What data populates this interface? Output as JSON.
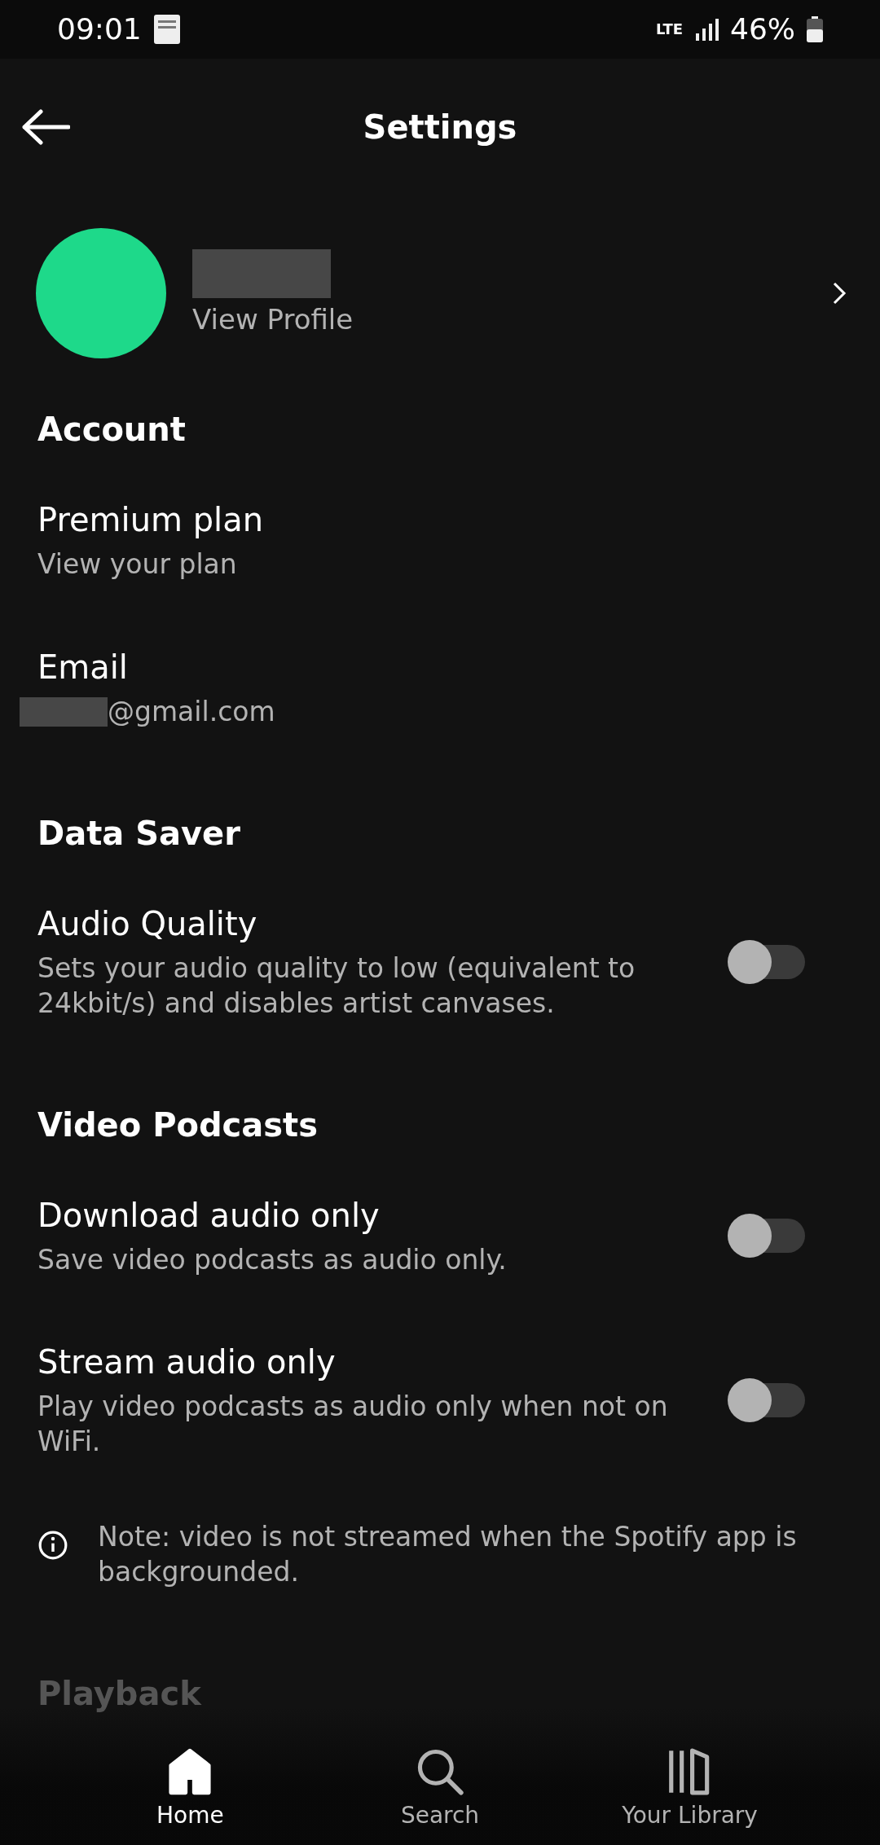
{
  "status_bar": {
    "time": "09:01",
    "network": "LTE",
    "battery": "46%"
  },
  "header": {
    "title": "Settings"
  },
  "profile": {
    "link": "View Profile"
  },
  "sections": [
    {
      "title": "Account",
      "items": [
        {
          "kind": "link",
          "title": "Premium plan",
          "subtitle": "View your plan"
        },
        {
          "kind": "email",
          "title": "Email",
          "subtitle": "@gmail.com"
        }
      ]
    },
    {
      "title": "Data Saver",
      "items": [
        {
          "kind": "toggle",
          "title": "Audio Quality",
          "subtitle": "Sets your audio quality to low (equivalent to 24kbit/s) and disables artist canvases.",
          "on": false
        }
      ]
    },
    {
      "title": "Video Podcasts",
      "items": [
        {
          "kind": "toggle",
          "title": "Download audio only",
          "subtitle": "Save video podcasts as audio only.",
          "on": false
        },
        {
          "kind": "toggle",
          "title": "Stream audio only",
          "subtitle": "Play video podcasts as audio only when not on WiFi.",
          "on": false
        },
        {
          "kind": "note",
          "subtitle": "Note: video is not streamed when the Spotify app is backgrounded."
        }
      ]
    },
    {
      "title": "Playback"
    }
  ],
  "nav": [
    {
      "label": "Home",
      "selected": true
    },
    {
      "label": "Search",
      "selected": false
    },
    {
      "label": "Your Library",
      "selected": false
    }
  ]
}
